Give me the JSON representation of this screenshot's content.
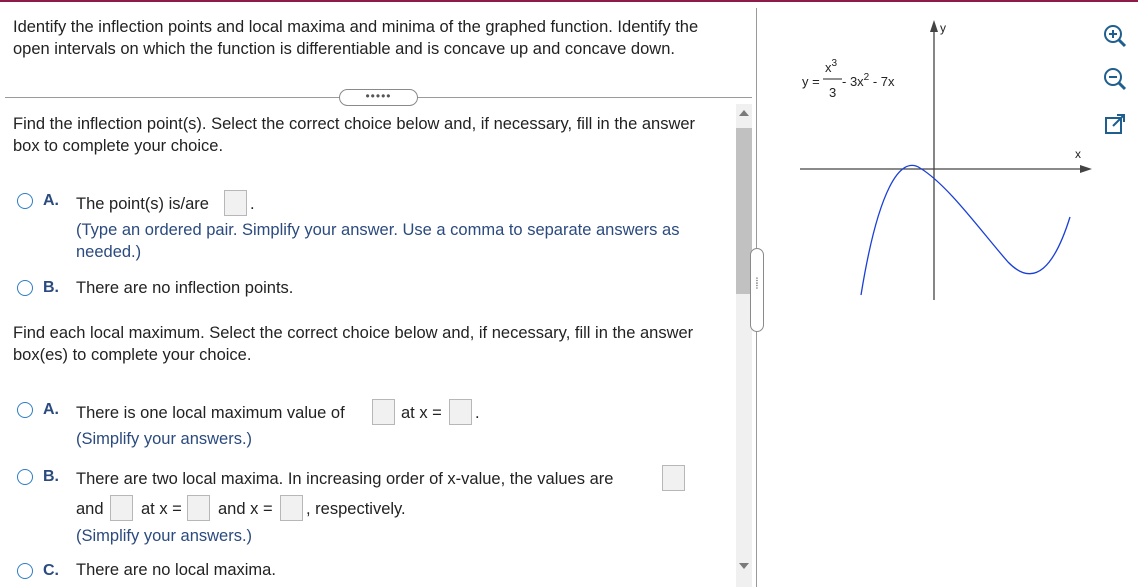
{
  "question": {
    "intro": "Identify the inflection points and local maxima and minima of the graphed function. Identify the open intervals on which the function is differentiable and is concave up and concave down.",
    "expander": "•••••",
    "part1": {
      "prompt": "Find the inflection point(s). Select the correct choice below and, if necessary, fill in the answer box to complete your choice.",
      "choiceA": {
        "letter": "A.",
        "text": "The point(s) is/are",
        "end": ".",
        "hint": "(Type an ordered pair. Simplify your answer. Use a comma to separate answers as needed.)"
      },
      "choiceB": {
        "letter": "B.",
        "text": "There are no inflection points."
      }
    },
    "part2": {
      "prompt": "Find each local maximum. Select the correct choice below and, if necessary, fill in the answer box(es) to complete your choice.",
      "choiceA": {
        "letter": "A.",
        "text": "There is one local maximum value of",
        "mid": "at x =",
        "end": ".",
        "hint": "(Simplify your answers.)"
      },
      "choiceB": {
        "letter": "B.",
        "text": "There are two local maxima. In increasing order of x-value, the values are",
        "and1": "and",
        "atx": "at x =",
        "andx": "and x =",
        "end": ", respectively.",
        "hint": "(Simplify your answers.)"
      },
      "choiceC": {
        "letter": "C.",
        "text": "There are no local maxima."
      }
    }
  },
  "graph": {
    "y_prefix": "y =",
    "numerator": "x",
    "num_exp": "3",
    "denominator": "3",
    "rest_a": " - 3x",
    "rest_exp": "2",
    "rest_b": " - 7x",
    "x_axis_label": "x",
    "y_axis_label": "y"
  },
  "tools": {
    "zoom_in": "zoom-in-icon",
    "zoom_out": "zoom-out-icon",
    "popout": "popout-icon"
  },
  "colors": {
    "accent": "#2e7dc7",
    "curve": "#1a3fd6",
    "hint": "#2b4a7e",
    "topline": "#8e1b4a"
  }
}
